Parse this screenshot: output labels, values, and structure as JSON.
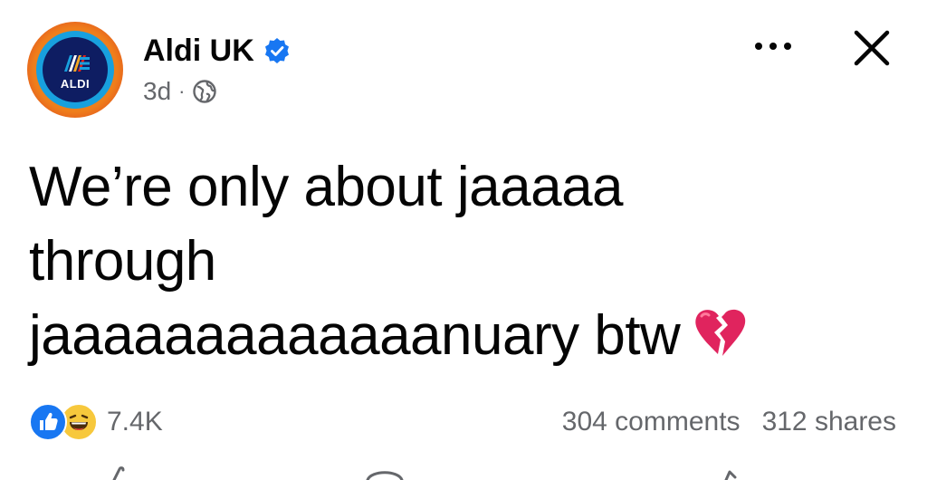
{
  "post": {
    "page_name": "Aldi UK",
    "time": "3d",
    "separator": "·",
    "avatar_text": "ALDI",
    "text_lines": [
      "We’re only about jaaaaa",
      "through",
      "jaaaaaaaaaaaaanuary btw"
    ],
    "emoji": "broken-heart"
  },
  "engagement": {
    "reaction_count": "7.4K",
    "comments": "304 comments",
    "shares": "312 shares"
  },
  "icons": {
    "verified": "verified-badge-icon",
    "audience": "globe-icon",
    "more": "more-options-icon",
    "close": "close-icon",
    "reactions": [
      "like-reaction-icon",
      "haha-reaction-icon"
    ]
  },
  "colors": {
    "verified_blue": "#1877f2",
    "secondary_text": "#65676b",
    "primary_text": "#050505",
    "broken_heart": "#e0245e"
  }
}
